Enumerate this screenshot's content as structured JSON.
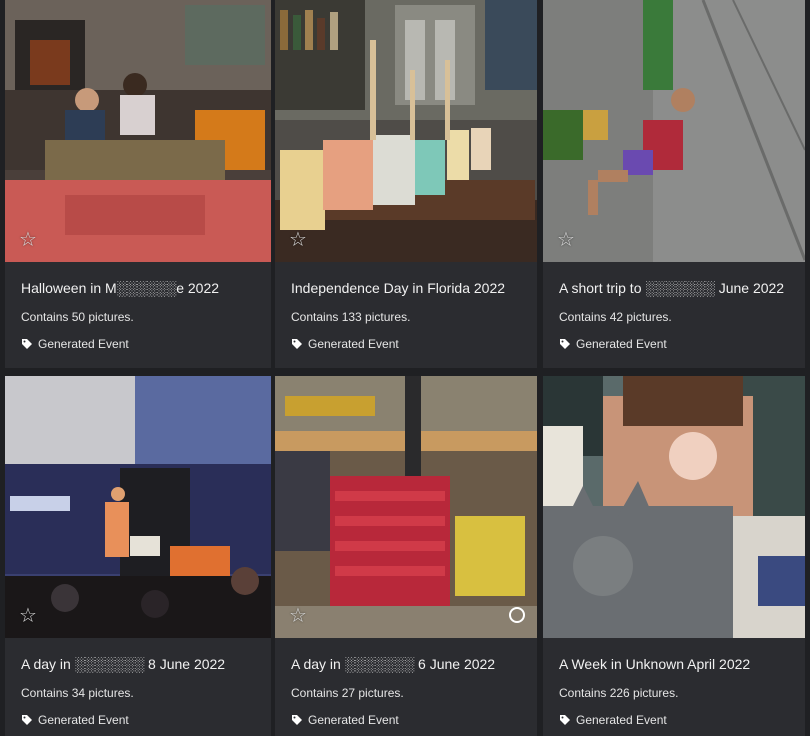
{
  "cards": [
    {
      "title": "Halloween in M░░░░░░e 2022",
      "count": "Contains 50 pictures.",
      "tag": "Generated Event",
      "favorite_icon": "star-outline-icon",
      "tag_icon": "tag-icon"
    },
    {
      "title": "Independence Day in Florida 2022",
      "count": "Contains 133 pictures.",
      "tag": "Generated Event",
      "favorite_icon": "star-outline-icon",
      "tag_icon": "tag-icon"
    },
    {
      "title": "A short trip to ░░░░░░░ June 2022",
      "count": "Contains 42 pictures.",
      "tag": "Generated Event",
      "favorite_icon": "star-outline-icon",
      "tag_icon": "tag-icon"
    },
    {
      "title": "A day in ░░░░░░░ 8 June 2022",
      "count": "Contains 34 pictures.",
      "tag": "Generated Event",
      "favorite_icon": "star-outline-icon",
      "tag_icon": "tag-icon"
    },
    {
      "title": "A day in ░░░░░░░ 6 June 2022",
      "count": "Contains 27 pictures.",
      "tag": "Generated Event",
      "favorite_icon": "star-outline-icon",
      "select_icon": "circle-select-icon",
      "tag_icon": "tag-icon"
    },
    {
      "title": "A Week in Unknown April 2022",
      "count": "Contains 226 pictures.",
      "tag": "Generated Event",
      "tag_icon": "tag-icon"
    }
  ],
  "star_glyph": "☆",
  "colors": {
    "background": "#1f2023",
    "card": "#2b2c30",
    "text": "#f1f1f1"
  }
}
